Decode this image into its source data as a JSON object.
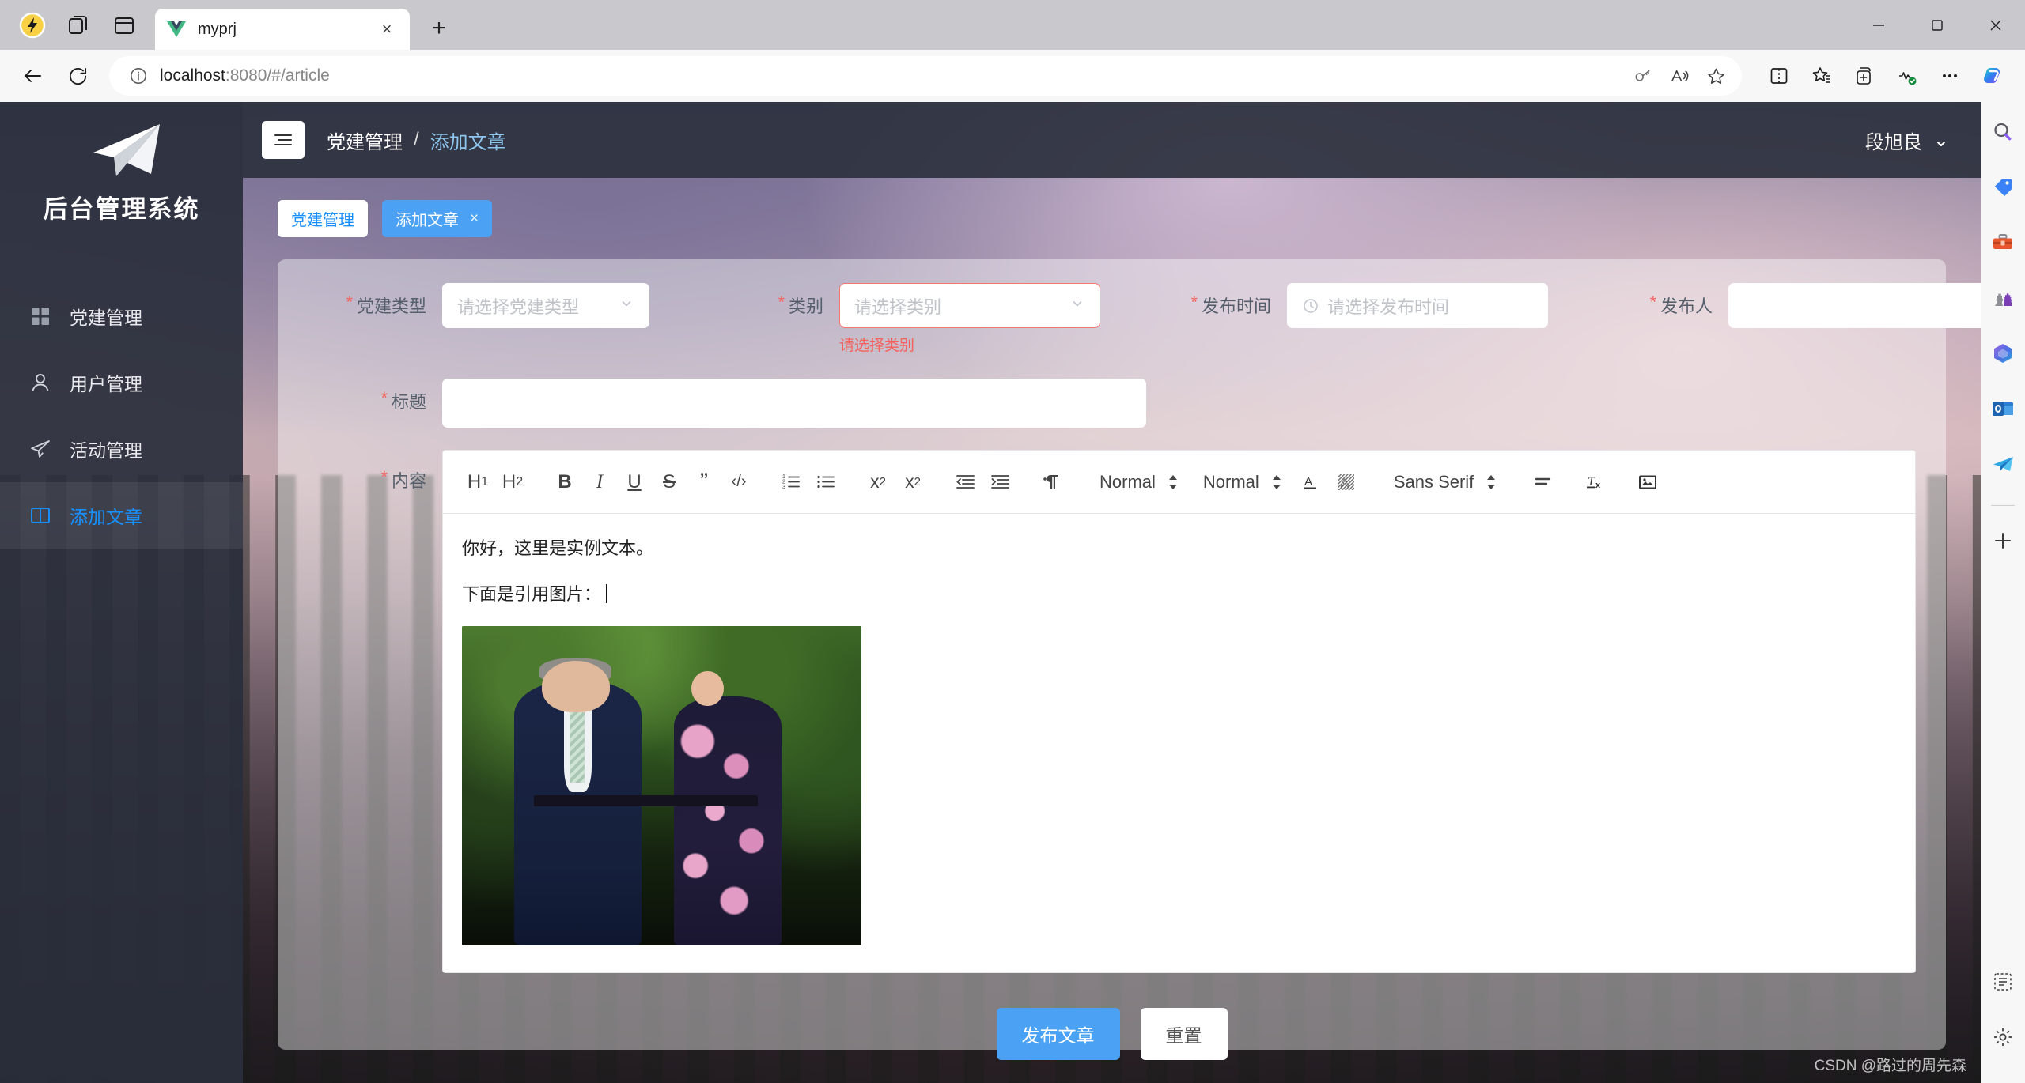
{
  "browser": {
    "tab": {
      "title": "myprj",
      "favicon": "vue-logo-icon",
      "close": "×"
    },
    "newtab_label": "+",
    "url_main": "localhost",
    "url_rest": ":8080/#/article",
    "toolbar_icons": [
      "back-arrow-icon",
      "reload-icon",
      "info-circle-icon",
      "key-icon",
      "read-aloud-icon",
      "favorite-star-icon",
      "split-screen-icon",
      "collections-icon",
      "add-tab-group-icon",
      "browser-essentials-icon",
      "more-options-icon",
      "copilot-icon"
    ],
    "window_controls": [
      "minimize",
      "maximize",
      "close"
    ],
    "edgebar_icons": [
      "search-icon",
      "price-tag-icon",
      "toolbox-icon",
      "games-icon",
      "microsoft365-icon",
      "outlook-icon",
      "paper-plane-icon",
      "add-icon",
      "customize-icon",
      "settings-gear-icon"
    ]
  },
  "sidebar": {
    "brand": "后台管理系统",
    "logo": "paper-plane-logo",
    "items": [
      {
        "label": "党建管理",
        "icon": "grid-icon",
        "active": false
      },
      {
        "label": "用户管理",
        "icon": "user-icon",
        "active": false
      },
      {
        "label": "活动管理",
        "icon": "send-icon",
        "active": false
      },
      {
        "label": "添加文章",
        "icon": "book-icon",
        "active": true
      }
    ]
  },
  "header": {
    "menu_toggle": "hamburger-icon",
    "breadcrumb": {
      "parent": "党建管理",
      "separator": "/",
      "current": "添加文章"
    },
    "user": {
      "name": "段旭良",
      "caret": "⌄"
    }
  },
  "tags": [
    {
      "label": "党建管理",
      "selected": false,
      "closable": false
    },
    {
      "label": "添加文章",
      "selected": true,
      "closable": true,
      "close": "×"
    }
  ],
  "form": {
    "fields": [
      {
        "key": "party_type",
        "label": "党建类型",
        "required": true,
        "placeholder": "请选择党建类型",
        "value": "",
        "type": "select",
        "error": ""
      },
      {
        "key": "category",
        "label": "类别",
        "required": true,
        "placeholder": "请选择类别",
        "value": "",
        "type": "select",
        "error": "请选择类别"
      },
      {
        "key": "publish_time",
        "label": "发布时间",
        "required": true,
        "placeholder": "请选择发布时间",
        "value": "",
        "type": "datetime",
        "error": ""
      },
      {
        "key": "publisher",
        "label": "发布人",
        "required": true,
        "placeholder": "",
        "value": "",
        "type": "text",
        "error": ""
      }
    ],
    "title_field": {
      "label": "标题",
      "required": true,
      "placeholder": "",
      "value": ""
    },
    "content_field": {
      "label": "内容",
      "required": true
    }
  },
  "editor": {
    "toolbar": {
      "buttons": [
        {
          "name": "heading-1-button",
          "glyph": "H₁"
        },
        {
          "name": "heading-2-button",
          "glyph": "H₂"
        },
        {
          "name": "bold-button",
          "glyph": "B"
        },
        {
          "name": "italic-button",
          "glyph": "I"
        },
        {
          "name": "underline-button",
          "glyph": "U"
        },
        {
          "name": "strikethrough-button",
          "glyph": "S"
        },
        {
          "name": "blockquote-button",
          "glyph": "❞"
        },
        {
          "name": "code-block-button",
          "glyph": "‹›"
        },
        {
          "name": "ordered-list-button",
          "glyph": "list"
        },
        {
          "name": "bullet-list-button",
          "glyph": "list"
        },
        {
          "name": "subscript-button",
          "glyph": "x₂"
        },
        {
          "name": "superscript-button",
          "glyph": "x²"
        },
        {
          "name": "outdent-button",
          "glyph": "indent"
        },
        {
          "name": "indent-button",
          "glyph": "indent"
        },
        {
          "name": "text-direction-button",
          "glyph": "¶"
        }
      ],
      "selects": [
        {
          "name": "header-size-select",
          "value": "Normal"
        },
        {
          "name": "line-height-select",
          "value": "Normal"
        },
        {
          "name": "font-family-select",
          "value": "Sans Serif"
        }
      ],
      "color_buttons": [
        {
          "name": "font-color-button",
          "glyph": "A"
        },
        {
          "name": "background-color-button",
          "glyph": "A"
        }
      ],
      "tail_buttons": [
        {
          "name": "align-button",
          "glyph": "align"
        },
        {
          "name": "clear-format-button",
          "glyph": "Tx"
        },
        {
          "name": "insert-image-button",
          "glyph": "image"
        }
      ]
    },
    "content": {
      "line1": "你好，这里是实例文本。",
      "line2": "下面是引用图片：",
      "image_alt": "两位穿正装的人站在绿树前的照片"
    }
  },
  "actions": {
    "submit": "发布文章",
    "reset": "重置"
  },
  "watermark": "CSDN @路过的周先森",
  "colors": {
    "accent": "#4ba2f5",
    "sidebar_bg": "#2a2e3b",
    "error": "#f5605a",
    "active_link": "#1890ff"
  }
}
